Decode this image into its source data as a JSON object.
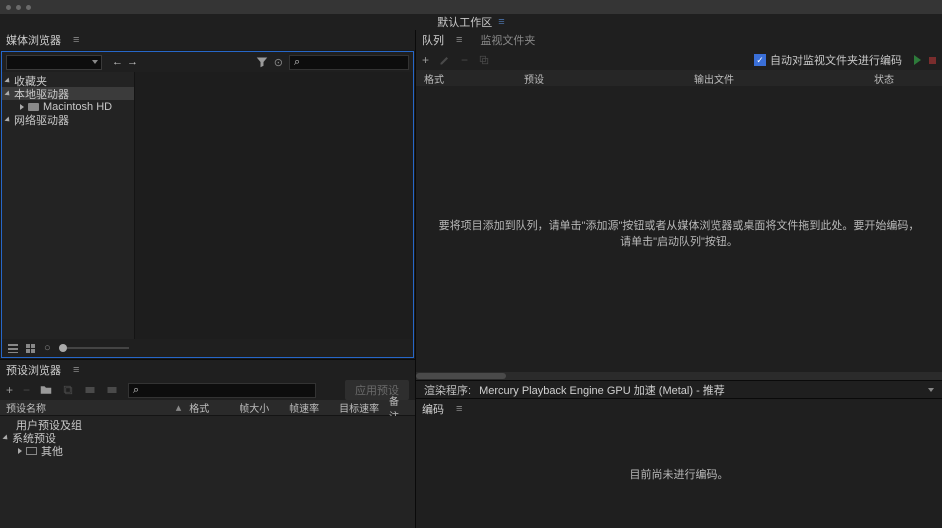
{
  "workspace": {
    "label": "默认工作区"
  },
  "media_browser": {
    "title": "媒体浏览器",
    "tree": {
      "favorites": "收藏夹",
      "local_drives": "本地驱动器",
      "macintosh_hd": "Macintosh HD",
      "network_drives": "网络驱动器"
    }
  },
  "preset_browser": {
    "title": "预设浏览器",
    "apply_label": "应用预设",
    "columns": {
      "name": "预设名称",
      "format": "格式",
      "frame_size": "帧大小",
      "frame_rate": "帧速率",
      "target_rate": "目标速率",
      "notes": "备注"
    },
    "tree": {
      "user": "用户预设及组",
      "system": "系统预设",
      "other": "其他"
    }
  },
  "queue": {
    "tab_queue": "队列",
    "tab_watch": "监视文件夹",
    "auto_encode_label": "自动对监视文件夹进行编码",
    "columns": {
      "format": "格式",
      "preset": "预设",
      "output": "输出文件",
      "status": "状态"
    },
    "hint": "要将项目添加到队列，请单击\"添加源\"按钮或者从媒体浏览器或桌面将文件拖到此处。要开始编码，请单击\"启动队列\"按钮。"
  },
  "render": {
    "label": "渲染程序:",
    "value": "Mercury Playback Engine GPU 加速 (Metal)  - 推荐"
  },
  "encode": {
    "title": "编码",
    "message": "目前尚未进行编码。"
  }
}
